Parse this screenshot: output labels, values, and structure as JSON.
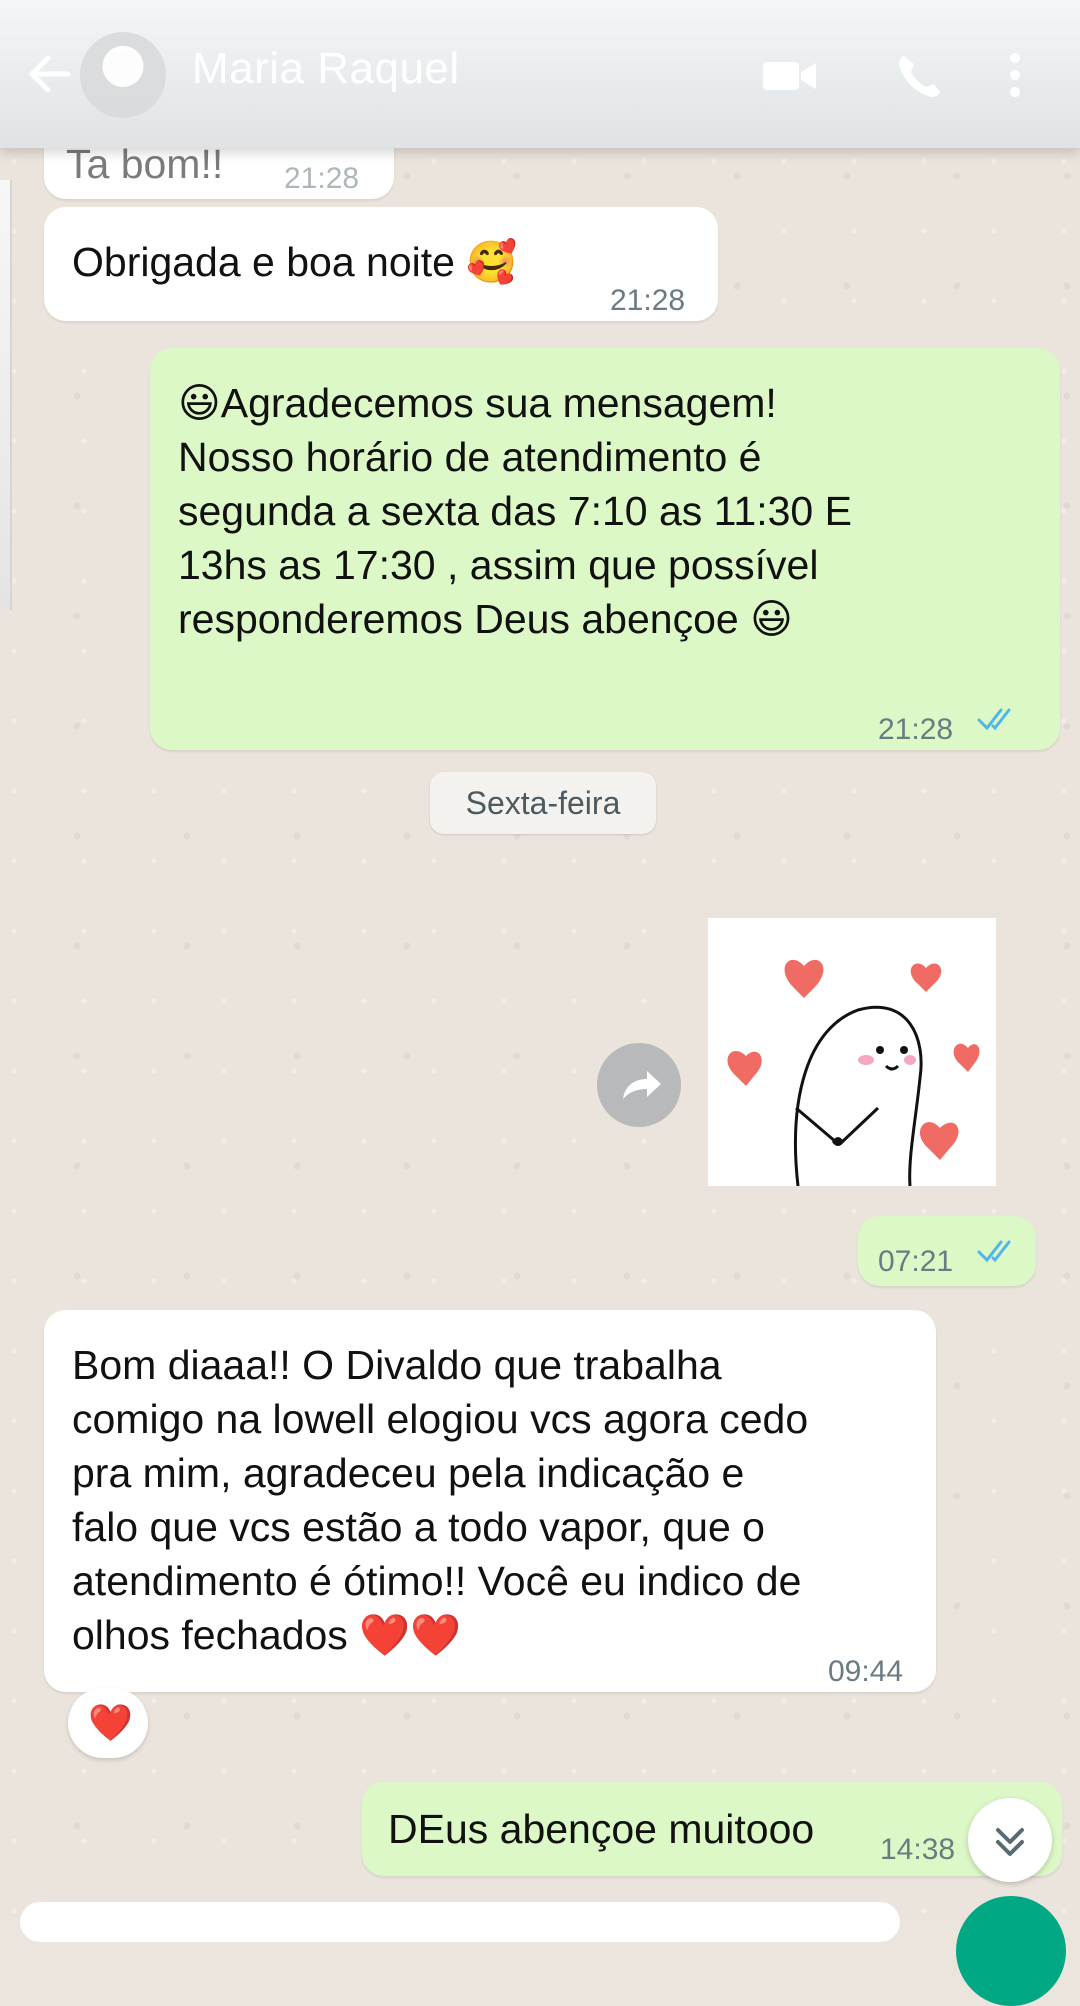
{
  "header": {
    "contact_name": "Maria Raquel",
    "back_icon": "arrow-left-icon",
    "video_icon": "video-call-icon",
    "call_icon": "phone-icon",
    "menu_icon": "more-vert-icon"
  },
  "messages": [
    {
      "direction": "in",
      "text": "Ta bom!!",
      "time": "21:28"
    },
    {
      "direction": "in",
      "text": "Obrigada e boa noite 🥰",
      "time": "21:28"
    },
    {
      "direction": "out",
      "lines": [
        "😃Agradecemos sua mensagem!",
        "Nosso  horário de atendimento é",
        "segunda a sexta das  7:10 as 11:30  E",
        "13hs as 17:30  , assim que possível",
        "responderemos Deus abençoe 😃"
      ],
      "time": "21:28",
      "status": "read"
    },
    {
      "direction": "out",
      "type": "sticker",
      "time": "07:21",
      "status": "read"
    },
    {
      "direction": "in",
      "lines": [
        "Bom diaaa!! O Divaldo que trabalha",
        "comigo na lowell elogiou vcs agora cedo",
        "pra mim, agradeceu pela indicação e",
        "falo que vcs estão a todo vapor, que o",
        "atendimento é ótimo!! Você eu indico de",
        "olhos fechados ❤️❤️"
      ],
      "time": "09:44",
      "reaction": "❤️"
    },
    {
      "direction": "out",
      "text": "DEus abençoe muitooo",
      "time": "14:38"
    }
  ],
  "date_separator": "Sexta-feira",
  "colors": {
    "outgoing": "#dcf8c6",
    "incoming": "#ffffff",
    "read_ticks": "#4fb6ec",
    "send": "#00a884"
  }
}
